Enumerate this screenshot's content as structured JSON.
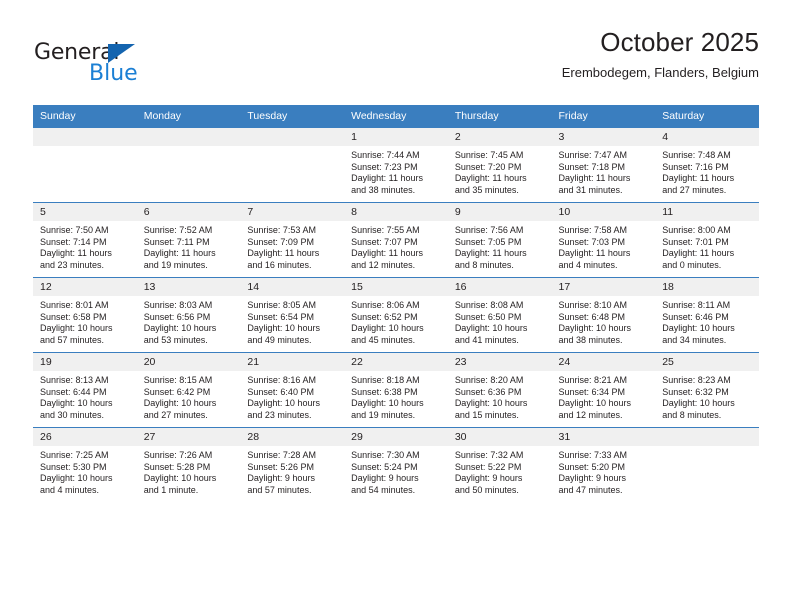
{
  "brand": {
    "name_top": "General",
    "name_bottom": "Blue",
    "accent_color": "#1b7fd4",
    "triangle_color": "#1464af"
  },
  "header": {
    "title": "October 2025",
    "subtitle": "Erembodegem, Flanders, Belgium"
  },
  "calendar": {
    "header_bg": "#3a7ebf",
    "daynum_bg": "#f0f0f0",
    "weekday_headers": [
      "Sunday",
      "Monday",
      "Tuesday",
      "Wednesday",
      "Thursday",
      "Friday",
      "Saturday"
    ],
    "weeks": [
      [
        {
          "day": "",
          "blank": true
        },
        {
          "day": "",
          "blank": true
        },
        {
          "day": "",
          "blank": true
        },
        {
          "day": "1",
          "sunrise": "Sunrise: 7:44 AM",
          "sunset": "Sunset: 7:23 PM",
          "daylight_line1": "Daylight: 11 hours",
          "daylight_line2": "and 38 minutes."
        },
        {
          "day": "2",
          "sunrise": "Sunrise: 7:45 AM",
          "sunset": "Sunset: 7:20 PM",
          "daylight_line1": "Daylight: 11 hours",
          "daylight_line2": "and 35 minutes."
        },
        {
          "day": "3",
          "sunrise": "Sunrise: 7:47 AM",
          "sunset": "Sunset: 7:18 PM",
          "daylight_line1": "Daylight: 11 hours",
          "daylight_line2": "and 31 minutes."
        },
        {
          "day": "4",
          "sunrise": "Sunrise: 7:48 AM",
          "sunset": "Sunset: 7:16 PM",
          "daylight_line1": "Daylight: 11 hours",
          "daylight_line2": "and 27 minutes."
        }
      ],
      [
        {
          "day": "5",
          "sunrise": "Sunrise: 7:50 AM",
          "sunset": "Sunset: 7:14 PM",
          "daylight_line1": "Daylight: 11 hours",
          "daylight_line2": "and 23 minutes."
        },
        {
          "day": "6",
          "sunrise": "Sunrise: 7:52 AM",
          "sunset": "Sunset: 7:11 PM",
          "daylight_line1": "Daylight: 11 hours",
          "daylight_line2": "and 19 minutes."
        },
        {
          "day": "7",
          "sunrise": "Sunrise: 7:53 AM",
          "sunset": "Sunset: 7:09 PM",
          "daylight_line1": "Daylight: 11 hours",
          "daylight_line2": "and 16 minutes."
        },
        {
          "day": "8",
          "sunrise": "Sunrise: 7:55 AM",
          "sunset": "Sunset: 7:07 PM",
          "daylight_line1": "Daylight: 11 hours",
          "daylight_line2": "and 12 minutes."
        },
        {
          "day": "9",
          "sunrise": "Sunrise: 7:56 AM",
          "sunset": "Sunset: 7:05 PM",
          "daylight_line1": "Daylight: 11 hours",
          "daylight_line2": "and 8 minutes."
        },
        {
          "day": "10",
          "sunrise": "Sunrise: 7:58 AM",
          "sunset": "Sunset: 7:03 PM",
          "daylight_line1": "Daylight: 11 hours",
          "daylight_line2": "and 4 minutes."
        },
        {
          "day": "11",
          "sunrise": "Sunrise: 8:00 AM",
          "sunset": "Sunset: 7:01 PM",
          "daylight_line1": "Daylight: 11 hours",
          "daylight_line2": "and 0 minutes."
        }
      ],
      [
        {
          "day": "12",
          "sunrise": "Sunrise: 8:01 AM",
          "sunset": "Sunset: 6:58 PM",
          "daylight_line1": "Daylight: 10 hours",
          "daylight_line2": "and 57 minutes."
        },
        {
          "day": "13",
          "sunrise": "Sunrise: 8:03 AM",
          "sunset": "Sunset: 6:56 PM",
          "daylight_line1": "Daylight: 10 hours",
          "daylight_line2": "and 53 minutes."
        },
        {
          "day": "14",
          "sunrise": "Sunrise: 8:05 AM",
          "sunset": "Sunset: 6:54 PM",
          "daylight_line1": "Daylight: 10 hours",
          "daylight_line2": "and 49 minutes."
        },
        {
          "day": "15",
          "sunrise": "Sunrise: 8:06 AM",
          "sunset": "Sunset: 6:52 PM",
          "daylight_line1": "Daylight: 10 hours",
          "daylight_line2": "and 45 minutes."
        },
        {
          "day": "16",
          "sunrise": "Sunrise: 8:08 AM",
          "sunset": "Sunset: 6:50 PM",
          "daylight_line1": "Daylight: 10 hours",
          "daylight_line2": "and 41 minutes."
        },
        {
          "day": "17",
          "sunrise": "Sunrise: 8:10 AM",
          "sunset": "Sunset: 6:48 PM",
          "daylight_line1": "Daylight: 10 hours",
          "daylight_line2": "and 38 minutes."
        },
        {
          "day": "18",
          "sunrise": "Sunrise: 8:11 AM",
          "sunset": "Sunset: 6:46 PM",
          "daylight_line1": "Daylight: 10 hours",
          "daylight_line2": "and 34 minutes."
        }
      ],
      [
        {
          "day": "19",
          "sunrise": "Sunrise: 8:13 AM",
          "sunset": "Sunset: 6:44 PM",
          "daylight_line1": "Daylight: 10 hours",
          "daylight_line2": "and 30 minutes."
        },
        {
          "day": "20",
          "sunrise": "Sunrise: 8:15 AM",
          "sunset": "Sunset: 6:42 PM",
          "daylight_line1": "Daylight: 10 hours",
          "daylight_line2": "and 27 minutes."
        },
        {
          "day": "21",
          "sunrise": "Sunrise: 8:16 AM",
          "sunset": "Sunset: 6:40 PM",
          "daylight_line1": "Daylight: 10 hours",
          "daylight_line2": "and 23 minutes."
        },
        {
          "day": "22",
          "sunrise": "Sunrise: 8:18 AM",
          "sunset": "Sunset: 6:38 PM",
          "daylight_line1": "Daylight: 10 hours",
          "daylight_line2": "and 19 minutes."
        },
        {
          "day": "23",
          "sunrise": "Sunrise: 8:20 AM",
          "sunset": "Sunset: 6:36 PM",
          "daylight_line1": "Daylight: 10 hours",
          "daylight_line2": "and 15 minutes."
        },
        {
          "day": "24",
          "sunrise": "Sunrise: 8:21 AM",
          "sunset": "Sunset: 6:34 PM",
          "daylight_line1": "Daylight: 10 hours",
          "daylight_line2": "and 12 minutes."
        },
        {
          "day": "25",
          "sunrise": "Sunrise: 8:23 AM",
          "sunset": "Sunset: 6:32 PM",
          "daylight_line1": "Daylight: 10 hours",
          "daylight_line2": "and 8 minutes."
        }
      ],
      [
        {
          "day": "26",
          "sunrise": "Sunrise: 7:25 AM",
          "sunset": "Sunset: 5:30 PM",
          "daylight_line1": "Daylight: 10 hours",
          "daylight_line2": "and 4 minutes."
        },
        {
          "day": "27",
          "sunrise": "Sunrise: 7:26 AM",
          "sunset": "Sunset: 5:28 PM",
          "daylight_line1": "Daylight: 10 hours",
          "daylight_line2": "and 1 minute."
        },
        {
          "day": "28",
          "sunrise": "Sunrise: 7:28 AM",
          "sunset": "Sunset: 5:26 PM",
          "daylight_line1": "Daylight: 9 hours",
          "daylight_line2": "and 57 minutes."
        },
        {
          "day": "29",
          "sunrise": "Sunrise: 7:30 AM",
          "sunset": "Sunset: 5:24 PM",
          "daylight_line1": "Daylight: 9 hours",
          "daylight_line2": "and 54 minutes."
        },
        {
          "day": "30",
          "sunrise": "Sunrise: 7:32 AM",
          "sunset": "Sunset: 5:22 PM",
          "daylight_line1": "Daylight: 9 hours",
          "daylight_line2": "and 50 minutes."
        },
        {
          "day": "31",
          "sunrise": "Sunrise: 7:33 AM",
          "sunset": "Sunset: 5:20 PM",
          "daylight_line1": "Daylight: 9 hours",
          "daylight_line2": "and 47 minutes."
        },
        {
          "day": "",
          "blank": true
        }
      ]
    ]
  }
}
